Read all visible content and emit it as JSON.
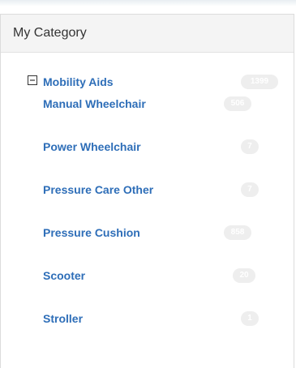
{
  "panel": {
    "title": "My Category",
    "parent": {
      "label": "Mobility Aids",
      "count": "1399",
      "expanded": true
    },
    "children": [
      {
        "label": "Manual Wheelchair",
        "count": "506"
      },
      {
        "label": "Power Wheelchair",
        "count": "7"
      },
      {
        "label": "Pressure Care Other",
        "count": "7"
      },
      {
        "label": "Pressure Cushion",
        "count": "858"
      },
      {
        "label": "Scooter",
        "count": "20"
      },
      {
        "label": "Stroller",
        "count": "1"
      }
    ]
  },
  "colors": {
    "link": "#2e6eb8",
    "badge_bg": "#eeeeee",
    "header_bg": "#f4f4f4"
  },
  "icons": {
    "toggle": "minus-square-icon"
  }
}
